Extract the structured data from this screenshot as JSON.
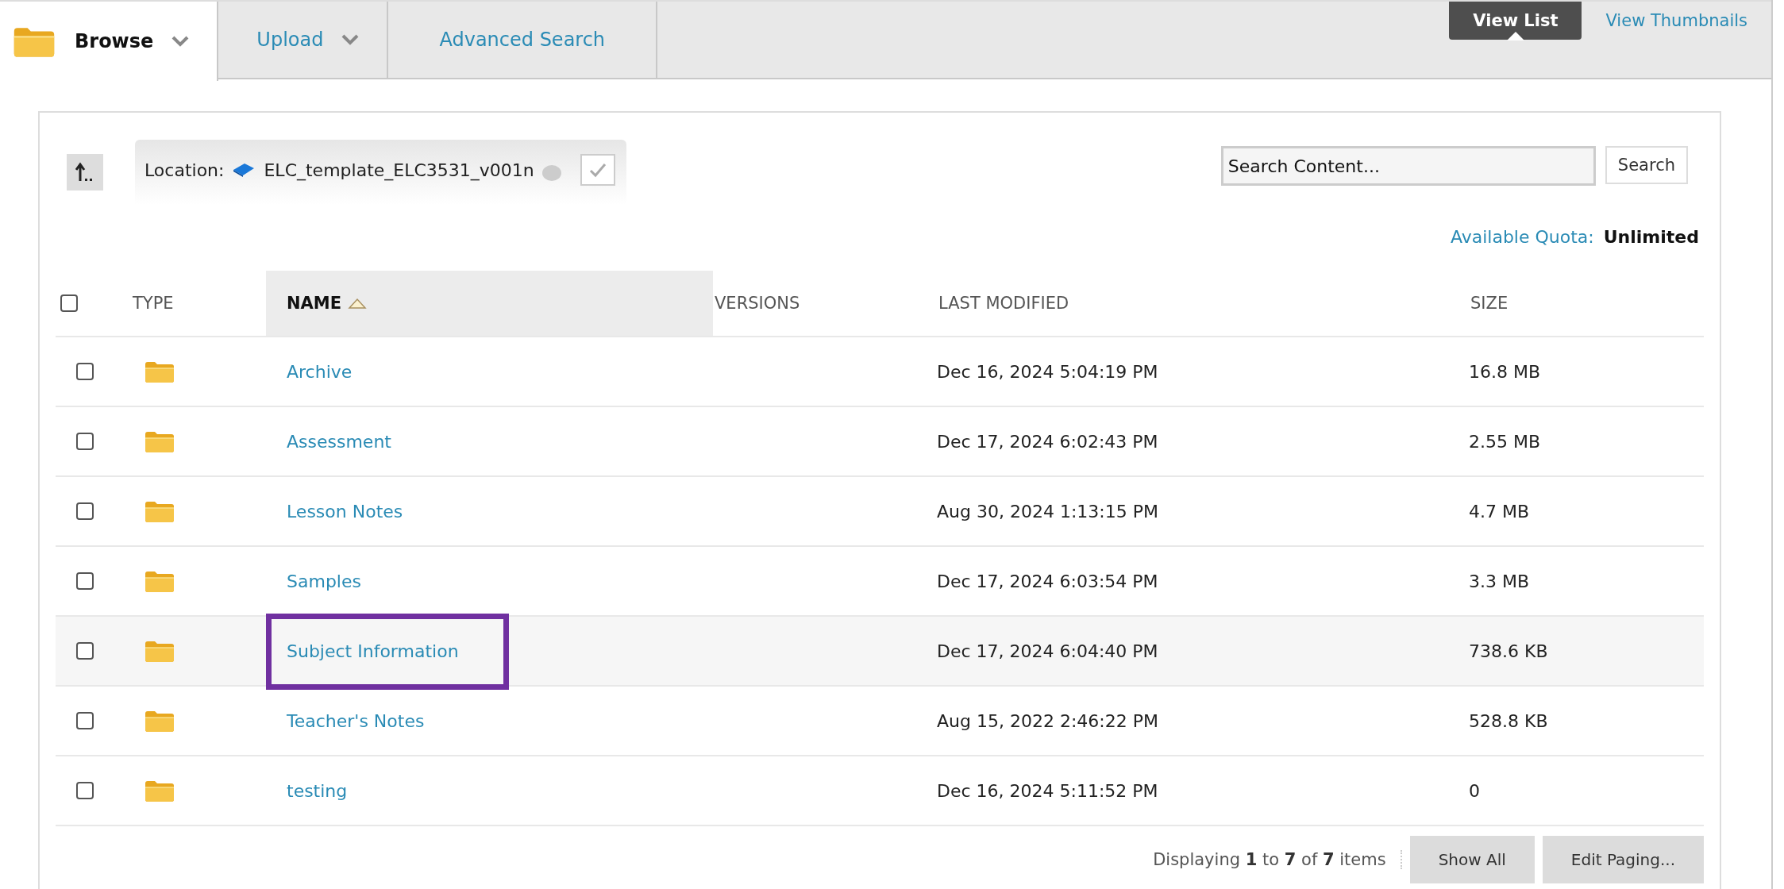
{
  "tabs": [
    {
      "label": "Browse",
      "selected": true,
      "has_menu": true
    },
    {
      "label": "Upload",
      "selected": false,
      "has_menu": true
    },
    {
      "label": "Advanced Search",
      "selected": false,
      "has_menu": false
    }
  ],
  "view_modes": [
    {
      "label": "View List",
      "selected": true
    },
    {
      "label": "View Thumbnails",
      "selected": false
    }
  ],
  "location": {
    "label": "Location:",
    "path": "ELC_template_ELC3531_v001n"
  },
  "search": {
    "placeholder": "Search Content...",
    "button": "Search"
  },
  "quota": {
    "label": "Available Quota:",
    "value": "Unlimited"
  },
  "table": {
    "select_all": {
      "checked": false
    },
    "columns": [
      {
        "label": "TYPE",
        "sorted": false
      },
      {
        "label": "NAME",
        "sorted": true
      },
      {
        "label": "VERSIONS",
        "sorted": false
      },
      {
        "label": "LAST MODIFIED",
        "sorted": false
      },
      {
        "label": "SIZE",
        "sorted": false
      }
    ],
    "rows": [
      {
        "name": "Archive",
        "last_modified": "Dec 16, 2024 5:04:19 PM",
        "size": "16.8 MB",
        "checked": false,
        "highlighted": false
      },
      {
        "name": "Assessment",
        "last_modified": "Dec 17, 2024 6:02:43 PM",
        "size": "2.55 MB",
        "checked": false,
        "highlighted": false
      },
      {
        "name": "Lesson Notes",
        "last_modified": "Aug 30, 2024 1:13:15 PM",
        "size": "4.7 MB",
        "checked": false,
        "highlighted": false
      },
      {
        "name": "Samples",
        "last_modified": "Dec 17, 2024 6:03:54 PM",
        "size": "3.3 MB",
        "checked": false,
        "highlighted": false
      },
      {
        "name": "Subject Information",
        "last_modified": "Dec 17, 2024 6:04:40 PM",
        "size": "738.6 KB",
        "checked": false,
        "highlighted": true
      },
      {
        "name": "Teacher's Notes",
        "last_modified": "Aug 15, 2022 2:46:22 PM",
        "size": "528.8 KB",
        "checked": false,
        "highlighted": false
      },
      {
        "name": "testing",
        "last_modified": "Dec 16, 2024 5:11:52 PM",
        "size": "0",
        "checked": false,
        "highlighted": false
      }
    ]
  },
  "footer": {
    "summary": "Displaying **1** to **7** of **7** items",
    "buttons": [
      "Show All",
      "Edit Paging..."
    ]
  }
}
